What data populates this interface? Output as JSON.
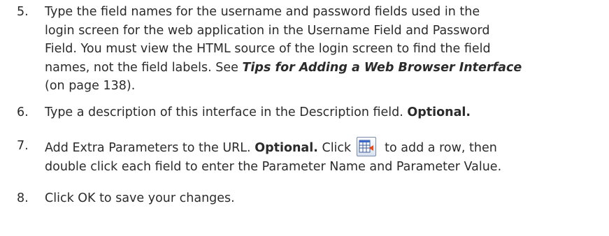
{
  "steps": [
    {
      "number": "5.",
      "lines": [
        "Type the field names for the username and password fields used in the",
        "login screen for the web application in the Username Field and Password",
        "Field. You must view the HTML source of the login screen to find the field"
      ],
      "line4_prefix": "names, not the field labels. See ",
      "link_text": "Tips for Adding a Web Browser Interface",
      "line5": "(on page 138)."
    },
    {
      "number": "6.",
      "text": "Type a description of this interface in the Description field. ",
      "bold": "Optional."
    },
    {
      "number": "7.",
      "prefix": "Add Extra Parameters to the URL. ",
      "bold": "Optional.",
      "click": " Click",
      "after_icon": "to add a row, then",
      "line2": "double click each field to enter the Parameter Name and Parameter Value.",
      "icon": "add-row-icon"
    },
    {
      "number": "8.",
      "text": "Click OK to save your changes."
    }
  ]
}
